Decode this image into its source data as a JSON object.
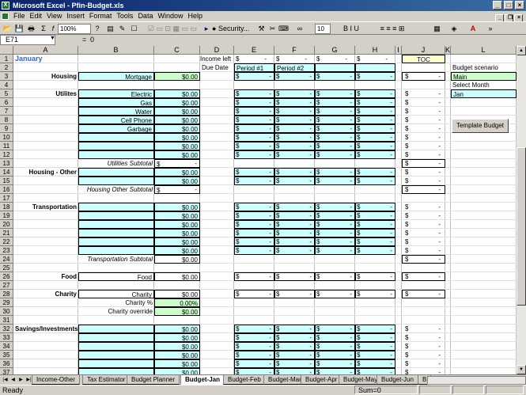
{
  "window": {
    "title": "Microsoft Excel - Pfin-Budget.xls"
  },
  "menu": [
    "File",
    "Edit",
    "View",
    "Insert",
    "Format",
    "Tools",
    "Data",
    "Window",
    "Help"
  ],
  "toolbar": {
    "zoom": "100%",
    "security": "Security...",
    "font_size": "10"
  },
  "formula": {
    "cell": "E71",
    "fx": "=",
    "value": "0"
  },
  "columns": [
    "A",
    "B",
    "C",
    "D",
    "E",
    "F",
    "G",
    "H",
    "I",
    "J",
    "K",
    "L"
  ],
  "rows": [
    "1",
    "2",
    "3",
    "4",
    "5",
    "6",
    "7",
    "8",
    "9",
    "10",
    "11",
    "12",
    "13",
    "14",
    "15",
    "16",
    "17",
    "18",
    "19",
    "20",
    "21",
    "22",
    "23",
    "24",
    "25",
    "26",
    "27",
    "28",
    "29",
    "30",
    "31",
    "32",
    "33",
    "34",
    "35",
    "36",
    "37"
  ],
  "sheet": {
    "month": "January",
    "income_left": "Income left",
    "due_date": "Due Date",
    "period1": "Period #1",
    "period2": "Period #2",
    "dollar": "$",
    "dash": "-",
    "zero": "$0.00",
    "zero_pct": "0.00%",
    "toc": "TOC",
    "budget_scenario_label": "Budget scenario",
    "budget_scenario": "Main",
    "select_month_label": "Select Month",
    "select_month": "Jan",
    "template_button": "Template Budget",
    "housing": "Housing",
    "mortgage": "Mortgage",
    "utilities": "Utilites",
    "electric": "Electric",
    "gas": "Gas",
    "water": "Water",
    "cell_phone": "Cell Phone",
    "garbage": "Garbage",
    "utilities_subtotal": "Utilities Subtotal",
    "housing_other": "Housing - Other",
    "housing_other_subtotal": "Housing Other Subtotal",
    "transportation": "Transportation",
    "transportation_subtotal": "Transportation Subtotal",
    "food": "Food",
    "food_item": "Food",
    "charity": "Charity",
    "charity_item": "Charity",
    "charity_pct": "Charity %",
    "charity_override": "Charity override",
    "savings": "Savings/Investments"
  },
  "tabs": [
    "Income-Other",
    "Tax Estimator",
    "Budget Planner",
    "Budget-Jan",
    "Budget-Feb",
    "Budget-Mar",
    "Budget-Apr",
    "Budget-May",
    "Budget-Jun",
    "B"
  ],
  "status": {
    "ready": "Ready",
    "sum": "Sum=0"
  }
}
